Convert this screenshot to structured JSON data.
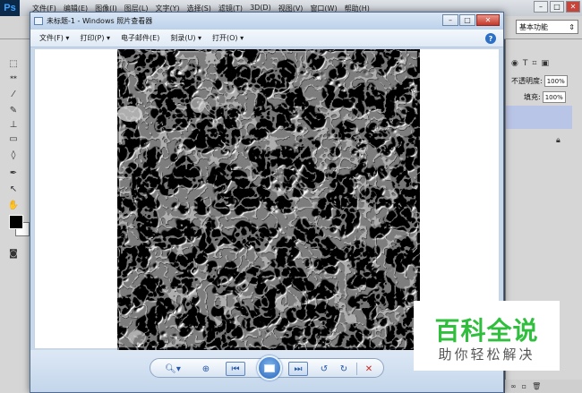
{
  "photoshop": {
    "logo": "Ps",
    "menu": [
      "文件(F)",
      "编辑(E)",
      "图像(I)",
      "图层(L)",
      "文字(Y)",
      "选择(S)",
      "滤镜(T)",
      "3D(D)",
      "视图(V)",
      "窗口(W)",
      "帮助(H)"
    ],
    "workspace": "基本功能",
    "panel": {
      "opacity_label": "不透明度:",
      "opacity_value": "100%",
      "fill_label": "填充:",
      "fill_value": "100%"
    }
  },
  "viewer": {
    "title": "未标题-1 - Windows 照片查看器",
    "menu": [
      "文件(F)",
      "打印(P)",
      "电子邮件(E)",
      "刻录(U)",
      "打开(O)"
    ],
    "help": "?"
  },
  "watermark": {
    "title": "百科全说",
    "subtitle": "助你轻松解决"
  },
  "colors": {
    "accent": "#2fbf3d",
    "viewer_frame": "#c9d9ec",
    "ps_chrome": "#d6d6d6"
  }
}
